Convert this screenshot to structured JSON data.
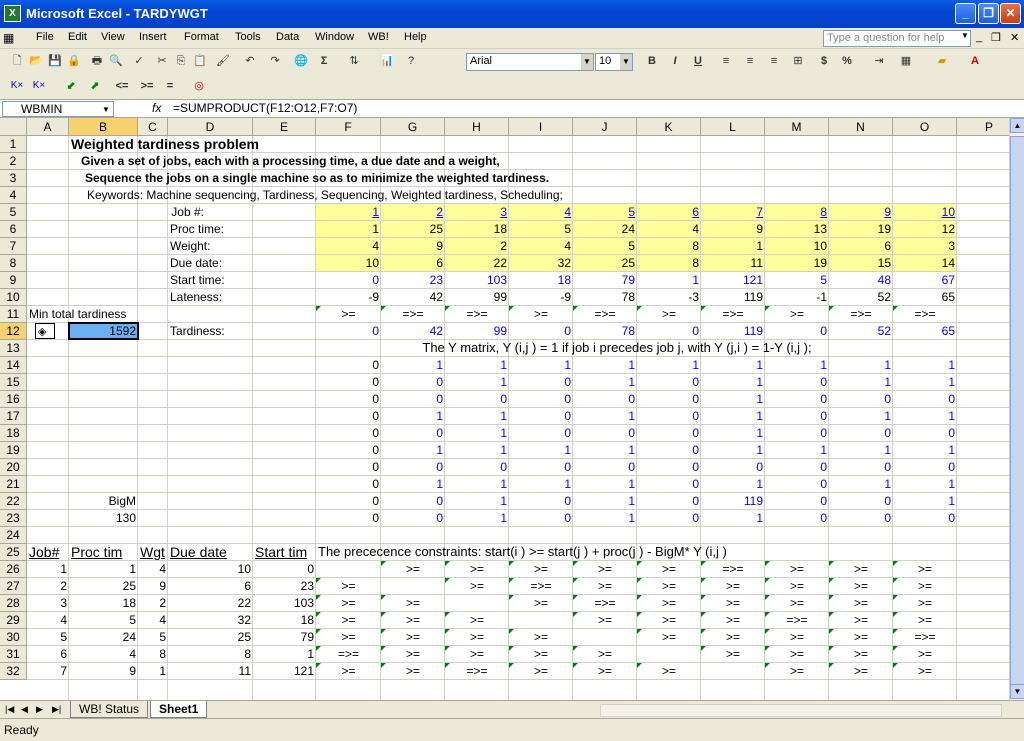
{
  "window": {
    "title": "Microsoft Excel - TARDYWGT"
  },
  "menu": [
    "File",
    "Edit",
    "View",
    "Insert",
    "Format",
    "Tools",
    "Data",
    "Window",
    "WB!",
    "Help"
  ],
  "ask_placeholder": "Type a question for help",
  "toolbar": {
    "font": "Arial",
    "size": "10",
    "bold": "B",
    "italic": "I",
    "underline": "U",
    "currency": "$",
    "percent": "%"
  },
  "toolbar2": {
    "le": "<=",
    "ge": ">=",
    "eq": "="
  },
  "formula_bar": {
    "name_box": "WBMIN",
    "fx": "fx",
    "formula": "=SUMPRODUCT(F12:O12,F7:O7)"
  },
  "columns": [
    "A",
    "B",
    "C",
    "D",
    "E",
    "F",
    "G",
    "H",
    "I",
    "J",
    "K",
    "L",
    "M",
    "N",
    "O",
    "P"
  ],
  "rows": [
    "1",
    "2",
    "3",
    "4",
    "5",
    "6",
    "7",
    "8",
    "9",
    "10",
    "11",
    "12",
    "13",
    "14",
    "15",
    "16",
    "17",
    "18",
    "19",
    "20",
    "21",
    "22",
    "23",
    "24",
    "25",
    "26",
    "27",
    "28",
    "29",
    "30",
    "31",
    "32"
  ],
  "texts": {
    "t1": "Weighted tardiness problem",
    "t2": "Given a set of jobs, each with a processing time, a due date and a weight,",
    "t3": "Sequence the jobs on a single machine so as to minimize the weighted tardiness.",
    "t4": "Keywords: Machine sequencing, Tardiness, Sequencing, Weighted tardiness, Scheduling;",
    "jobno": "Job #:",
    "proc": "Proc time:",
    "weight": "Weight:",
    "due": "Due date:",
    "start": "Start time:",
    "late": "Lateness:",
    "tard": "Tardiness:",
    "mintot": "Min total tardiness",
    "objval": "1592",
    "ymat": "The Y matrix, Y (i,j ) = 1 if job i  precedes job j,  with Y (j,i ) = 1-Y (i,j );",
    "bigm": "BigM",
    "bigmval": "130",
    "hdr_job": "Job#",
    "hdr_proc": "Proc tim",
    "hdr_wgt": "Wgt",
    "hdr_due": "Due date",
    "hdr_start": "Start tim",
    "prec": "The prececence constraints:  start(i ) >= start(j ) + proc(j ) - BigM* Y (i,j )"
  },
  "jobs": {
    "num": [
      "1",
      "2",
      "3",
      "4",
      "5",
      "6",
      "7",
      "8",
      "9",
      "10"
    ],
    "proc": [
      "1",
      "25",
      "18",
      "5",
      "24",
      "4",
      "9",
      "13",
      "19",
      "12"
    ],
    "wgt": [
      "4",
      "9",
      "2",
      "4",
      "5",
      "8",
      "1",
      "10",
      "6",
      "3"
    ],
    "due": [
      "10",
      "6",
      "22",
      "32",
      "25",
      "8",
      "11",
      "19",
      "15",
      "14"
    ],
    "start": [
      "0",
      "23",
      "103",
      "18",
      "79",
      "1",
      "121",
      "5",
      "48",
      "67"
    ],
    "late": [
      "-9",
      "42",
      "99",
      "-9",
      "78",
      "-3",
      "119",
      "-1",
      "52",
      "65"
    ],
    "cmp": [
      ">=",
      "=>=",
      "=>=",
      ">=",
      "=>=",
      ">=",
      "=>=",
      ">=",
      "=>=",
      "=>="
    ],
    "tard": [
      "0",
      "42",
      "99",
      "0",
      "78",
      "0",
      "119",
      "0",
      "52",
      "65"
    ]
  },
  "ymatrix": [
    [
      "0",
      "1",
      "1",
      "1",
      "1",
      "1",
      "1",
      "1",
      "1",
      "1"
    ],
    [
      "0",
      "0",
      "1",
      "0",
      "1",
      "0",
      "1",
      "0",
      "1",
      "1"
    ],
    [
      "0",
      "0",
      "0",
      "0",
      "0",
      "0",
      "1",
      "0",
      "0",
      "0"
    ],
    [
      "0",
      "1",
      "1",
      "0",
      "1",
      "0",
      "1",
      "0",
      "1",
      "1"
    ],
    [
      "0",
      "0",
      "1",
      "0",
      "0",
      "0",
      "1",
      "0",
      "0",
      "0"
    ],
    [
      "0",
      "1",
      "1",
      "1",
      "1",
      "0",
      "1",
      "1",
      "1",
      "1"
    ],
    [
      "0",
      "0",
      "0",
      "0",
      "0",
      "0",
      "0",
      "0",
      "0",
      "0"
    ],
    [
      "0",
      "1",
      "1",
      "1",
      "1",
      "0",
      "1",
      "0",
      "1",
      "1"
    ],
    [
      "0",
      "0",
      "1",
      "0",
      "1",
      "0",
      "119",
      "0",
      "0",
      "1"
    ],
    [
      "0",
      "0",
      "1",
      "0",
      "1",
      "0",
      "1",
      "0",
      "0",
      "0"
    ]
  ],
  "table": [
    [
      "1",
      "1",
      "4",
      "10",
      "0"
    ],
    [
      "2",
      "25",
      "9",
      "6",
      "23"
    ],
    [
      "3",
      "18",
      "2",
      "22",
      "103"
    ],
    [
      "4",
      "5",
      "4",
      "32",
      "18"
    ],
    [
      "5",
      "24",
      "5",
      "25",
      "79"
    ],
    [
      "6",
      "4",
      "8",
      "8",
      "1"
    ],
    [
      "7",
      "9",
      "1",
      "11",
      "121"
    ]
  ],
  "prec": [
    [
      "",
      ">=",
      ">=",
      ">=",
      ">=",
      ">=",
      "=>=",
      ">=",
      ">=",
      ">="
    ],
    [
      ">=",
      "",
      ">=",
      "=>=",
      ">=",
      ">=",
      ">=",
      ">=",
      ">=",
      ">="
    ],
    [
      ">=",
      ">=",
      "",
      ">=",
      "=>=",
      ">=",
      ">=",
      ">=",
      ">=",
      ">="
    ],
    [
      ">=",
      ">=",
      ">=",
      "",
      ">=",
      ">=",
      ">=",
      "=>=",
      ">=",
      ">="
    ],
    [
      ">=",
      ">=",
      ">=",
      ">=",
      "",
      ">=",
      ">=",
      ">=",
      ">=",
      "=>="
    ],
    [
      "=>=",
      ">=",
      ">=",
      ">=",
      ">=",
      "",
      ">=",
      ">=",
      ">=",
      ">="
    ],
    [
      ">=",
      ">=",
      "=>=",
      ">=",
      ">=",
      ">=",
      "",
      ">=",
      ">=",
      ">="
    ]
  ],
  "sheets": [
    "WB! Status",
    "Sheet1"
  ],
  "status": "Ready"
}
